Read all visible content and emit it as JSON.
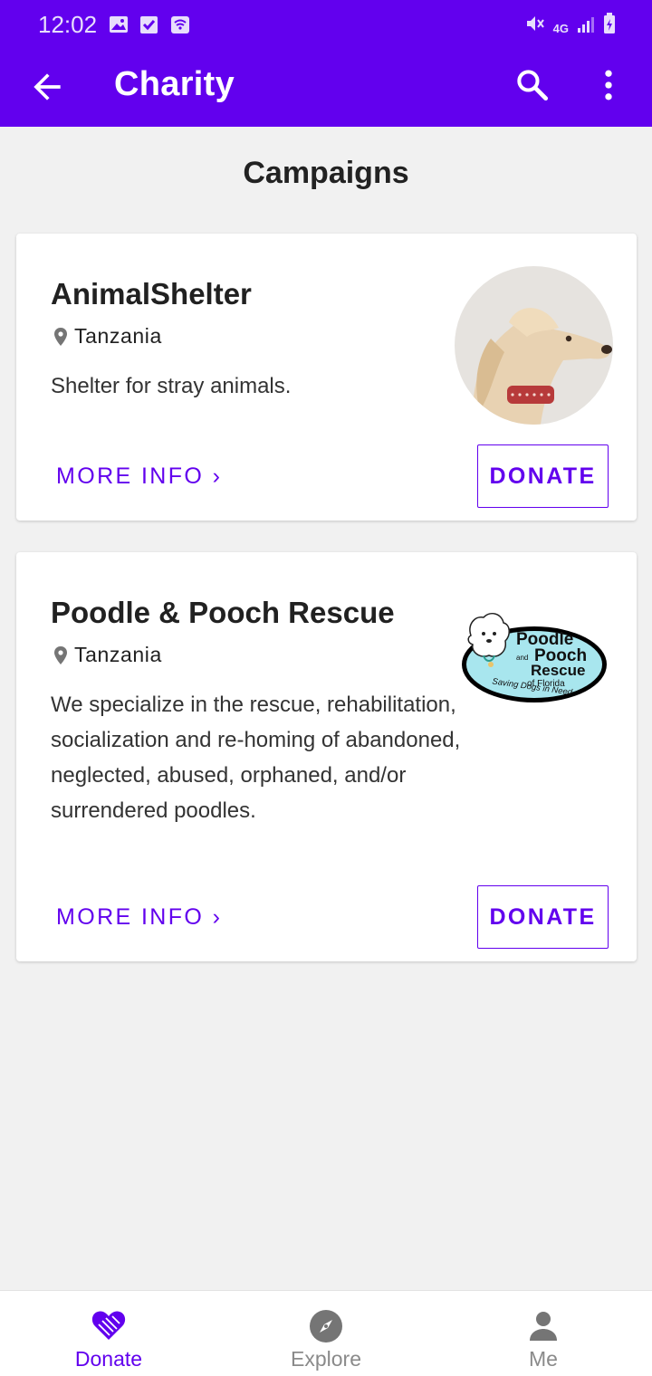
{
  "status_bar": {
    "time": "12:02",
    "network": "4G"
  },
  "app_bar": {
    "title": "Charity"
  },
  "section": {
    "title": "Campaigns"
  },
  "campaigns": [
    {
      "name": "AnimalShelter",
      "location": "Tanzania",
      "description": "Shelter for stray animals.",
      "more_info_label": "MORE INFO ›",
      "donate_label": "DONATE"
    },
    {
      "name": "Poodle & Pooch Rescue",
      "location": "Tanzania",
      "description": "We specialize in the rescue, rehabilitation, socialization and re-homing of abandoned, neglected, abused, orphaned, and/or surrendered poodles.",
      "more_info_label": "MORE INFO ›",
      "donate_label": "DONATE",
      "logo_text": {
        "line1": "Poodle",
        "line2_small": "and",
        "line2": "Pooch",
        "line3": "Rescue",
        "line4": "of Florida",
        "tagline": "Saving Dogs in Need"
      }
    }
  ],
  "bottom_nav": [
    {
      "label": "Donate",
      "icon": "heart-hand-icon",
      "active": true
    },
    {
      "label": "Explore",
      "icon": "compass-icon",
      "active": false
    },
    {
      "label": "Me",
      "icon": "person-icon",
      "active": false
    }
  ],
  "colors": {
    "primary": "#6200ee",
    "background": "#f1f1f1",
    "inactive": "#757575"
  }
}
